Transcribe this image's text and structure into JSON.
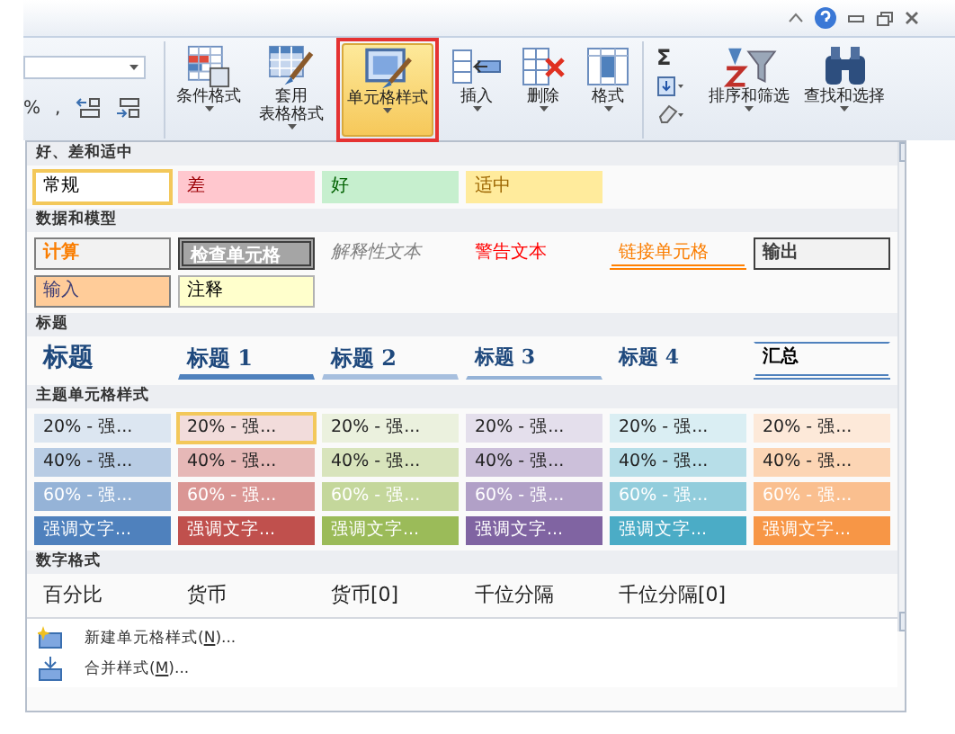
{
  "ribbon": {
    "number_buttons": [
      "%",
      ","
    ],
    "buttons": [
      {
        "kind": "conditional",
        "lines": [
          "条件格式"
        ],
        "selected": false
      },
      {
        "kind": "table",
        "lines": [
          "套用",
          "表格格式"
        ],
        "selected": false
      },
      {
        "kind": "cellstyle",
        "lines": [
          "单元格样式"
        ],
        "selected": true
      },
      {
        "kind": "insert",
        "lines": [
          "插入"
        ],
        "selected": false
      },
      {
        "kind": "delete",
        "lines": [
          "删除"
        ],
        "selected": false
      },
      {
        "kind": "format",
        "lines": [
          "格式"
        ],
        "selected": false
      }
    ],
    "sum_symbol": "Σ",
    "buttons2": [
      {
        "kind": "sort",
        "lines": [
          "排序和筛选"
        ],
        "selected": false
      },
      {
        "kind": "find",
        "lines": [
          "查找和选择"
        ],
        "selected": false
      }
    ]
  },
  "gallery": {
    "sections": [
      {
        "title": "好、差和适中",
        "rows": [
          [
            {
              "label": "常规",
              "kind": "normal",
              "selected": true
            },
            {
              "label": "差",
              "kind": "bad",
              "selected": false
            },
            {
              "label": "好",
              "kind": "good",
              "selected": false
            },
            {
              "label": "适中",
              "kind": "neutral",
              "selected": false
            }
          ]
        ]
      },
      {
        "title": "数据和模型",
        "rows": [
          [
            {
              "label": "计算",
              "kind": "calc",
              "selected": false
            },
            {
              "label": "检查单元格",
              "kind": "check",
              "selected": false
            },
            {
              "label": "解释性文本",
              "kind": "explanatory",
              "selected": false
            },
            {
              "label": "警告文本",
              "kind": "warning",
              "selected": false
            },
            {
              "label": "链接单元格",
              "kind": "linked",
              "selected": false
            },
            {
              "label": "输出",
              "kind": "output",
              "selected": false
            }
          ],
          [
            {
              "label": "输入",
              "kind": "input",
              "selected": false
            },
            {
              "label": "注释",
              "kind": "note",
              "selected": false
            }
          ]
        ]
      },
      {
        "title": "标题",
        "rows": [
          [
            {
              "label": "标题",
              "kind": "title",
              "selected": false
            },
            {
              "label": "标题 1",
              "kind": "heading1",
              "selected": false
            },
            {
              "label": "标题 2",
              "kind": "heading2",
              "selected": false
            },
            {
              "label": "标题 3",
              "kind": "heading3",
              "selected": false
            },
            {
              "label": "标题 4",
              "kind": "heading4",
              "selected": false
            },
            {
              "label": "汇总",
              "kind": "total",
              "selected": false
            }
          ]
        ]
      },
      {
        "title": "主题单元格样式",
        "rows": [
          [
            {
              "label": "20% - 强...",
              "kind": "light",
              "color": "#dce6f1",
              "selected": false
            },
            {
              "label": "20% - 强...",
              "kind": "light",
              "color": "#f2dcdb",
              "selected": true
            },
            {
              "label": "20% - 强...",
              "kind": "light",
              "color": "#ebf1de",
              "selected": false
            },
            {
              "label": "20% - 强...",
              "kind": "light",
              "color": "#e4dfec",
              "selected": false
            },
            {
              "label": "20% - 强...",
              "kind": "light",
              "color": "#daeef3",
              "selected": false
            },
            {
              "label": "20% - 强...",
              "kind": "light",
              "color": "#fde9d9",
              "selected": false
            }
          ],
          [
            {
              "label": "40% - 强...",
              "kind": "light",
              "color": "#b8cce4",
              "selected": false
            },
            {
              "label": "40% - 强...",
              "kind": "light",
              "color": "#e6b8b7",
              "selected": false
            },
            {
              "label": "40% - 强...",
              "kind": "light",
              "color": "#d8e4bc",
              "selected": false
            },
            {
              "label": "40% - 强...",
              "kind": "light",
              "color": "#ccc0da",
              "selected": false
            },
            {
              "label": "40% - 强...",
              "kind": "light",
              "color": "#b7dee8",
              "selected": false
            },
            {
              "label": "40% - 强...",
              "kind": "light",
              "color": "#fcd5b4",
              "selected": false
            }
          ],
          [
            {
              "label": "60% - 强...",
              "kind": "strong",
              "color": "#95b3d7",
              "selected": false
            },
            {
              "label": "60% - 强...",
              "kind": "strong",
              "color": "#da9694",
              "selected": false
            },
            {
              "label": "60% - 强...",
              "kind": "strong",
              "color": "#c4d79b",
              "selected": false
            },
            {
              "label": "60% - 强...",
              "kind": "strong",
              "color": "#b1a0c7",
              "selected": false
            },
            {
              "label": "60% - 强...",
              "kind": "strong",
              "color": "#92cddc",
              "selected": false
            },
            {
              "label": "60% - 强...",
              "kind": "strong",
              "color": "#fabf8f",
              "selected": false
            }
          ],
          [
            {
              "label": "强调文字...",
              "kind": "strong",
              "color": "#4f81bd",
              "selected": false
            },
            {
              "label": "强调文字...",
              "kind": "strong",
              "color": "#c0504d",
              "selected": false
            },
            {
              "label": "强调文字...",
              "kind": "strong",
              "color": "#9bbb59",
              "selected": false
            },
            {
              "label": "强调文字...",
              "kind": "strong",
              "color": "#8064a2",
              "selected": false
            },
            {
              "label": "强调文字...",
              "kind": "strong",
              "color": "#4bacc6",
              "selected": false
            },
            {
              "label": "强调文字...",
              "kind": "strong",
              "color": "#f79646",
              "selected": false
            }
          ]
        ]
      },
      {
        "title": "数字格式",
        "rows": [
          [
            {
              "label": "百分比",
              "kind": "plain",
              "selected": false
            },
            {
              "label": "货币",
              "kind": "plain",
              "selected": false
            },
            {
              "label": "货币[0]",
              "kind": "plain",
              "selected": false
            },
            {
              "label": "千位分隔",
              "kind": "plain",
              "selected": false
            },
            {
              "label": "千位分隔[0]",
              "kind": "plain",
              "selected": false
            }
          ]
        ]
      }
    ],
    "menu": [
      {
        "kind": "new",
        "before": "新建单元格样式(",
        "hotkey": "N",
        "after": ")..."
      },
      {
        "kind": "merge",
        "before": "合并样式(",
        "hotkey": "M",
        "after": ")..."
      }
    ]
  }
}
